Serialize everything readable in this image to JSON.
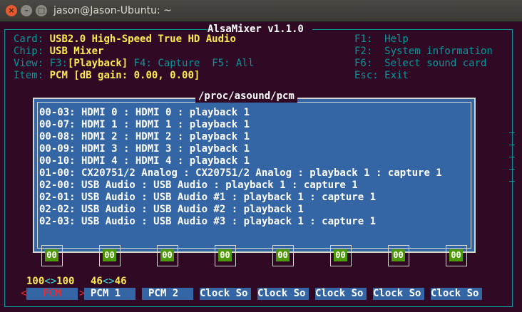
{
  "window": {
    "title": "jason@Jason-Ubuntu: ~",
    "close_glyph": "×",
    "min_glyph": "–",
    "max_glyph": "□"
  },
  "app": {
    "title": "AlsaMixer v1.1.0"
  },
  "info": {
    "card_label": "Card:",
    "card_value": "USB2.0 High-Speed True HD Audio",
    "chip_label": "Chip:",
    "chip_value": "USB Mixer",
    "view_label": "View:",
    "view_f3": "F3:",
    "view_playback": "[Playback]",
    "view_f4": "F4: Capture",
    "view_f5": "F5: All",
    "item_label": "Item:",
    "item_value": "PCM [dB gain: 0.00, 0.00]"
  },
  "help": {
    "f1": "F1:  Help",
    "f2": "F2:  System information",
    "f6": "F6:  Select sound card",
    "esc": "Esc: Exit"
  },
  "proc": {
    "title": "/proc/asound/pcm",
    "lines": [
      "00-03: HDMI 0 : HDMI 0 : playback 1",
      "00-07: HDMI 1 : HDMI 1 : playback 1",
      "00-08: HDMI 2 : HDMI 2 : playback 1",
      "00-09: HDMI 3 : HDMI 3 : playback 1",
      "00-10: HDMI 4 : HDMI 4 : playback 1",
      "01-00: CX20751/2 Analog : CX20751/2 Analog : playback 1 : capture 1",
      "02-00: USB Audio : USB Audio : playback 1 : capture 1",
      "02-01: USB Audio : USB Audio #1 : playback 1 : capture 1",
      "02-02: USB Audio : USB Audio #2 : playback 1",
      "02-03: USB Audio : USB Audio #3 : playback 1 : capture 1"
    ]
  },
  "mutes": [
    "00",
    "00",
    "00",
    "00",
    "00",
    "00",
    "00",
    "00"
  ],
  "levels": {
    "pcm_left": "100",
    "pcm_arrows": "<>",
    "pcm_right": "100",
    "pcm1_left": "46",
    "pcm1_arrows": "<>",
    "pcm1_right": "46"
  },
  "selector": {
    "left": "<",
    "right": ">"
  },
  "channels": [
    "PCM",
    "PCM 1",
    "PCM 2",
    "Clock So",
    "Clock So",
    "Clock So",
    "Clock So",
    "Clock So"
  ],
  "colors": {
    "background": "#300a24",
    "frame": "#06989a",
    "label": "#06989a",
    "highlight": "#fce94f",
    "dialog": "#3465a4",
    "mute_on": "#4e9a06",
    "selected": "#ef2929"
  }
}
